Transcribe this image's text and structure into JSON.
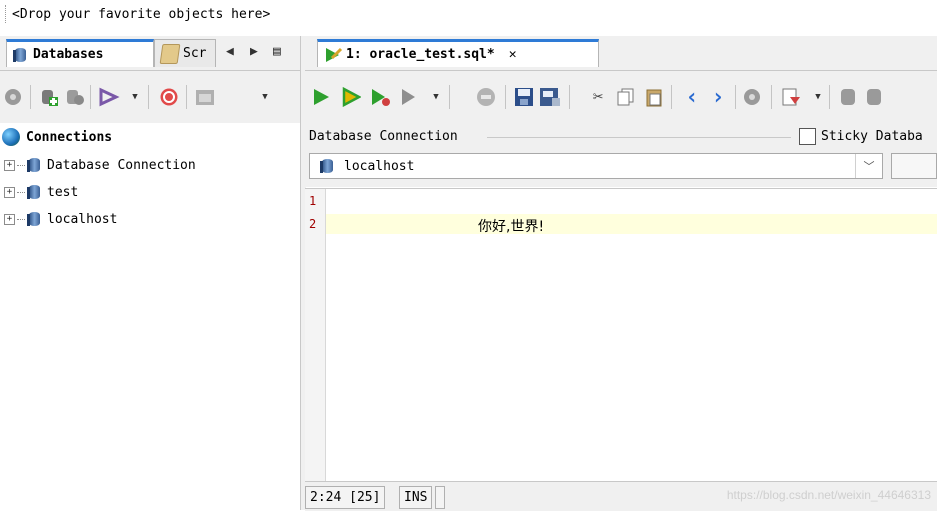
{
  "favorites": {
    "text": "<Drop your favorite objects here>"
  },
  "left_tabs": [
    {
      "label": "Databases",
      "active": true
    },
    {
      "label": "Scr",
      "active": false
    }
  ],
  "left_tab_nav": {
    "prev": "◀",
    "next": "▶",
    "menu": "▤"
  },
  "tree": {
    "root": "Connections",
    "items": [
      "Database Connection",
      "test",
      "localhost"
    ]
  },
  "editor_tab": {
    "label": "1: oracle_test.sql*",
    "close": "✕"
  },
  "connection_panel": {
    "legend": "Database Connection",
    "sticky_label": "Sticky Databa",
    "selected": "localhost"
  },
  "editor": {
    "line_numbers": [
      "1",
      "2"
    ],
    "lines": [
      "",
      "你好,世界!"
    ]
  },
  "status": {
    "position": "2:24 [25]",
    "mode": "INS",
    "watermark": "https://blog.csdn.net/weixin_44646313"
  },
  "colors": {
    "active_tab_accent": "#2e7bd6",
    "run_green": "#2ea02e",
    "current_line": "#ffffdd",
    "line_number": "#a00000"
  }
}
